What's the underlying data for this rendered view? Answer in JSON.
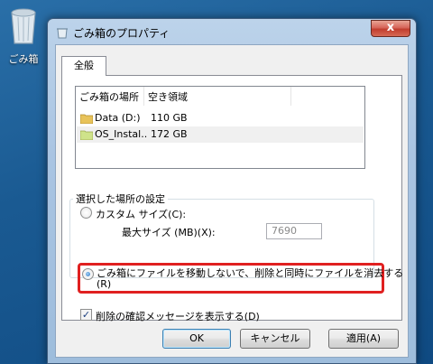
{
  "desktop": {
    "recycle_bin_label": "ごみ箱"
  },
  "window": {
    "title": "ごみ箱のプロパティ",
    "close_glyph": "x"
  },
  "tabs": [
    {
      "label": "全般"
    }
  ],
  "list": {
    "headers": [
      "ごみ箱の場所",
      "空き領域"
    ],
    "rows": [
      {
        "name": "Data (D:)",
        "space": "110 GB"
      },
      {
        "name": "OS_Instal...",
        "space": "172 GB"
      }
    ]
  },
  "settings": {
    "group_label": "選択した場所の設定",
    "custom_size_label": "カスタム サイズ(C):",
    "max_size_label": "最大サイズ (MB)(X):",
    "max_size_value": "7690",
    "delete_immediately_label_line1": "ごみ箱にファイルを移動しないで、削除と同時にファイルを消去する",
    "delete_immediately_label_line2": "(R)",
    "confirm_label": "削除の確認メッセージを表示する(D)",
    "selected_option": "delete_immediately",
    "confirm_checked": true
  },
  "buttons": {
    "ok": "OK",
    "cancel": "キャンセル",
    "apply": "適用(A)"
  },
  "colors": {
    "highlight": "#e02020",
    "desktop": "#1a5a92",
    "dialog_bg": "#f0f0f0"
  }
}
